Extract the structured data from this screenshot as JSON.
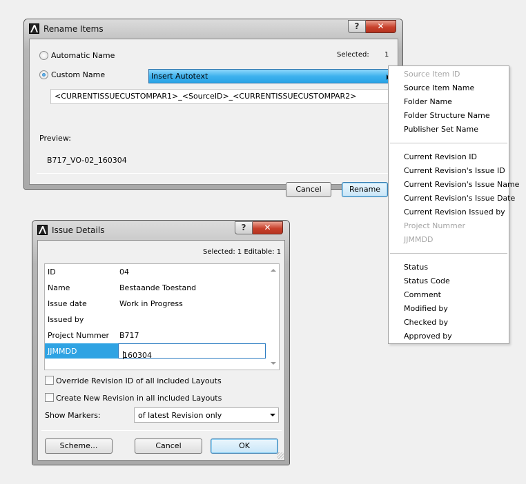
{
  "rename_dialog": {
    "title": "Rename Items",
    "help_icon": "help-icon",
    "close_icon": "close-icon",
    "automatic_label": "Automatic Name",
    "selected_label": "Selected:",
    "selected_count": "1",
    "custom_label": "Custom Name",
    "insert_autotext": "Insert Autotext",
    "pattern_value": "<CURRENTISSUECUSTOMPAR1>_<SourceID>_<CURRENTISSUECUSTOMPAR2>",
    "preview_label": "Preview:",
    "preview_value": "B717_VO-02_160304",
    "cancel_label": "Cancel",
    "rename_label": "Rename"
  },
  "autotext_menu": {
    "items": [
      {
        "label": "Source Item ID",
        "enabled": false
      },
      {
        "label": "Source Item Name",
        "enabled": true
      },
      {
        "label": "Folder Name",
        "enabled": true
      },
      {
        "label": "Folder Structure Name",
        "enabled": true
      },
      {
        "label": "Publisher Set Name",
        "enabled": true
      },
      {
        "label": "Current Revision ID",
        "enabled": true
      },
      {
        "label": "Current Revision's Issue ID",
        "enabled": true
      },
      {
        "label": "Current Revision's Issue Name",
        "enabled": true
      },
      {
        "label": "Current Revision's Issue Date",
        "enabled": true
      },
      {
        "label": "Current Revision Issued by",
        "enabled": true
      },
      {
        "label": "Project Nummer",
        "enabled": false
      },
      {
        "label": "JJMMDD",
        "enabled": false
      },
      {
        "label": "Status",
        "enabled": true
      },
      {
        "label": "Status Code",
        "enabled": true
      },
      {
        "label": "Comment",
        "enabled": true
      },
      {
        "label": "Modified by",
        "enabled": true
      },
      {
        "label": "Checked by",
        "enabled": true
      },
      {
        "label": "Approved by",
        "enabled": true
      }
    ]
  },
  "issue_dialog": {
    "title": "Issue Details",
    "selected_editable": "Selected: 1 Editable: 1",
    "rows": [
      {
        "key": "ID",
        "value": "04"
      },
      {
        "key": "Name",
        "value": "Bestaande Toestand"
      },
      {
        "key": "Issue date",
        "value": "Work in Progress"
      },
      {
        "key": "Issued by",
        "value": ""
      },
      {
        "key": "Project Nummer",
        "value": "B717"
      },
      {
        "key": "JJMMDD",
        "value": "160304"
      }
    ],
    "override_label": "Override Revision ID of all included Layouts",
    "create_label": "Create New Revision in all included Layouts",
    "markers_label": "Show Markers:",
    "markers_value": "of latest Revision only",
    "scheme_label": "Scheme...",
    "cancel_label": "Cancel",
    "ok_label": "OK"
  }
}
